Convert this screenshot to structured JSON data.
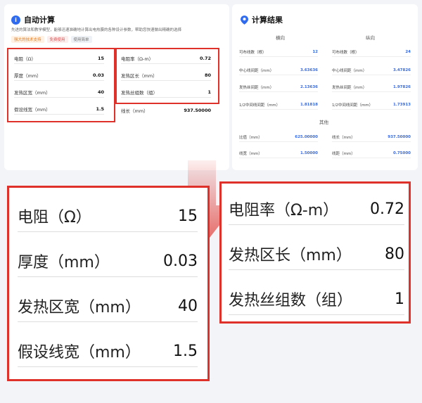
{
  "auto_calc": {
    "title": "自动计算",
    "description": "先进的算法和教学模型，能够迅速准确地计算出电热膜的各种设计参数，帮助您快速做出精确的选择",
    "tags": [
      "强大的技术支持",
      "免费使用",
      "使用简单"
    ],
    "left_fields": [
      {
        "label": "电阻（Ω）",
        "value": "15"
      },
      {
        "label": "厚度（mm）",
        "value": "0.03"
      },
      {
        "label": "发热区宽（mm）",
        "value": "40"
      },
      {
        "label": "假设线宽（mm）",
        "value": "1.5"
      }
    ],
    "right_fields": [
      {
        "label": "电阻率（Ω-m）",
        "value": "0.72"
      },
      {
        "label": "发热区长（mm）",
        "value": "80"
      },
      {
        "label": "发热丝组数（组）",
        "value": "1"
      }
    ],
    "extra_field": {
      "label": "线长（mm）",
      "value": "937.50000"
    }
  },
  "results": {
    "title": "计算结果",
    "col_left": "横向",
    "col_right": "纵向",
    "left_rows": [
      {
        "label": "可布线数（根）",
        "value": "12"
      },
      {
        "label": "中心线间距（mm）",
        "value": "3.63636"
      },
      {
        "label": "发热丝间距（mm）",
        "value": "2.13636"
      },
      {
        "label": "1/2中间线间距（mm）",
        "value": "1.81818"
      }
    ],
    "right_rows": [
      {
        "label": "可布线数（根）",
        "value": "24"
      },
      {
        "label": "中心线间距（mm）",
        "value": "3.47826"
      },
      {
        "label": "发热丝间距（mm）",
        "value": "1.97826"
      },
      {
        "label": "1/2中间线间距（mm）",
        "value": "1.73913"
      }
    ],
    "other_title": "其他",
    "other_left": [
      {
        "label": "比值（mm）",
        "value": "625.00000"
      },
      {
        "label": "线宽（mm）",
        "value": "1.50000"
      }
    ],
    "other_right": [
      {
        "label": "线长（mm）",
        "value": "937.50000"
      },
      {
        "label": "线距（mm）",
        "value": "0.75000"
      }
    ]
  },
  "zoom_left": [
    {
      "label": "电阻（Ω）",
      "value": "15"
    },
    {
      "label": "厚度（mm）",
      "value": "0.03"
    },
    {
      "label": "发热区宽（mm）",
      "value": "40"
    },
    {
      "label": "假设线宽（mm）",
      "value": "1.5"
    }
  ],
  "zoom_right": [
    {
      "label": "电阻率（Ω-m）",
      "value": "0.72"
    },
    {
      "label": "发热区长（mm）",
      "value": "80"
    },
    {
      "label": "发热丝组数（组）",
      "value": "1"
    }
  ],
  "colors": {
    "highlight": "#e0302a",
    "accent": "#2f6bf0"
  }
}
